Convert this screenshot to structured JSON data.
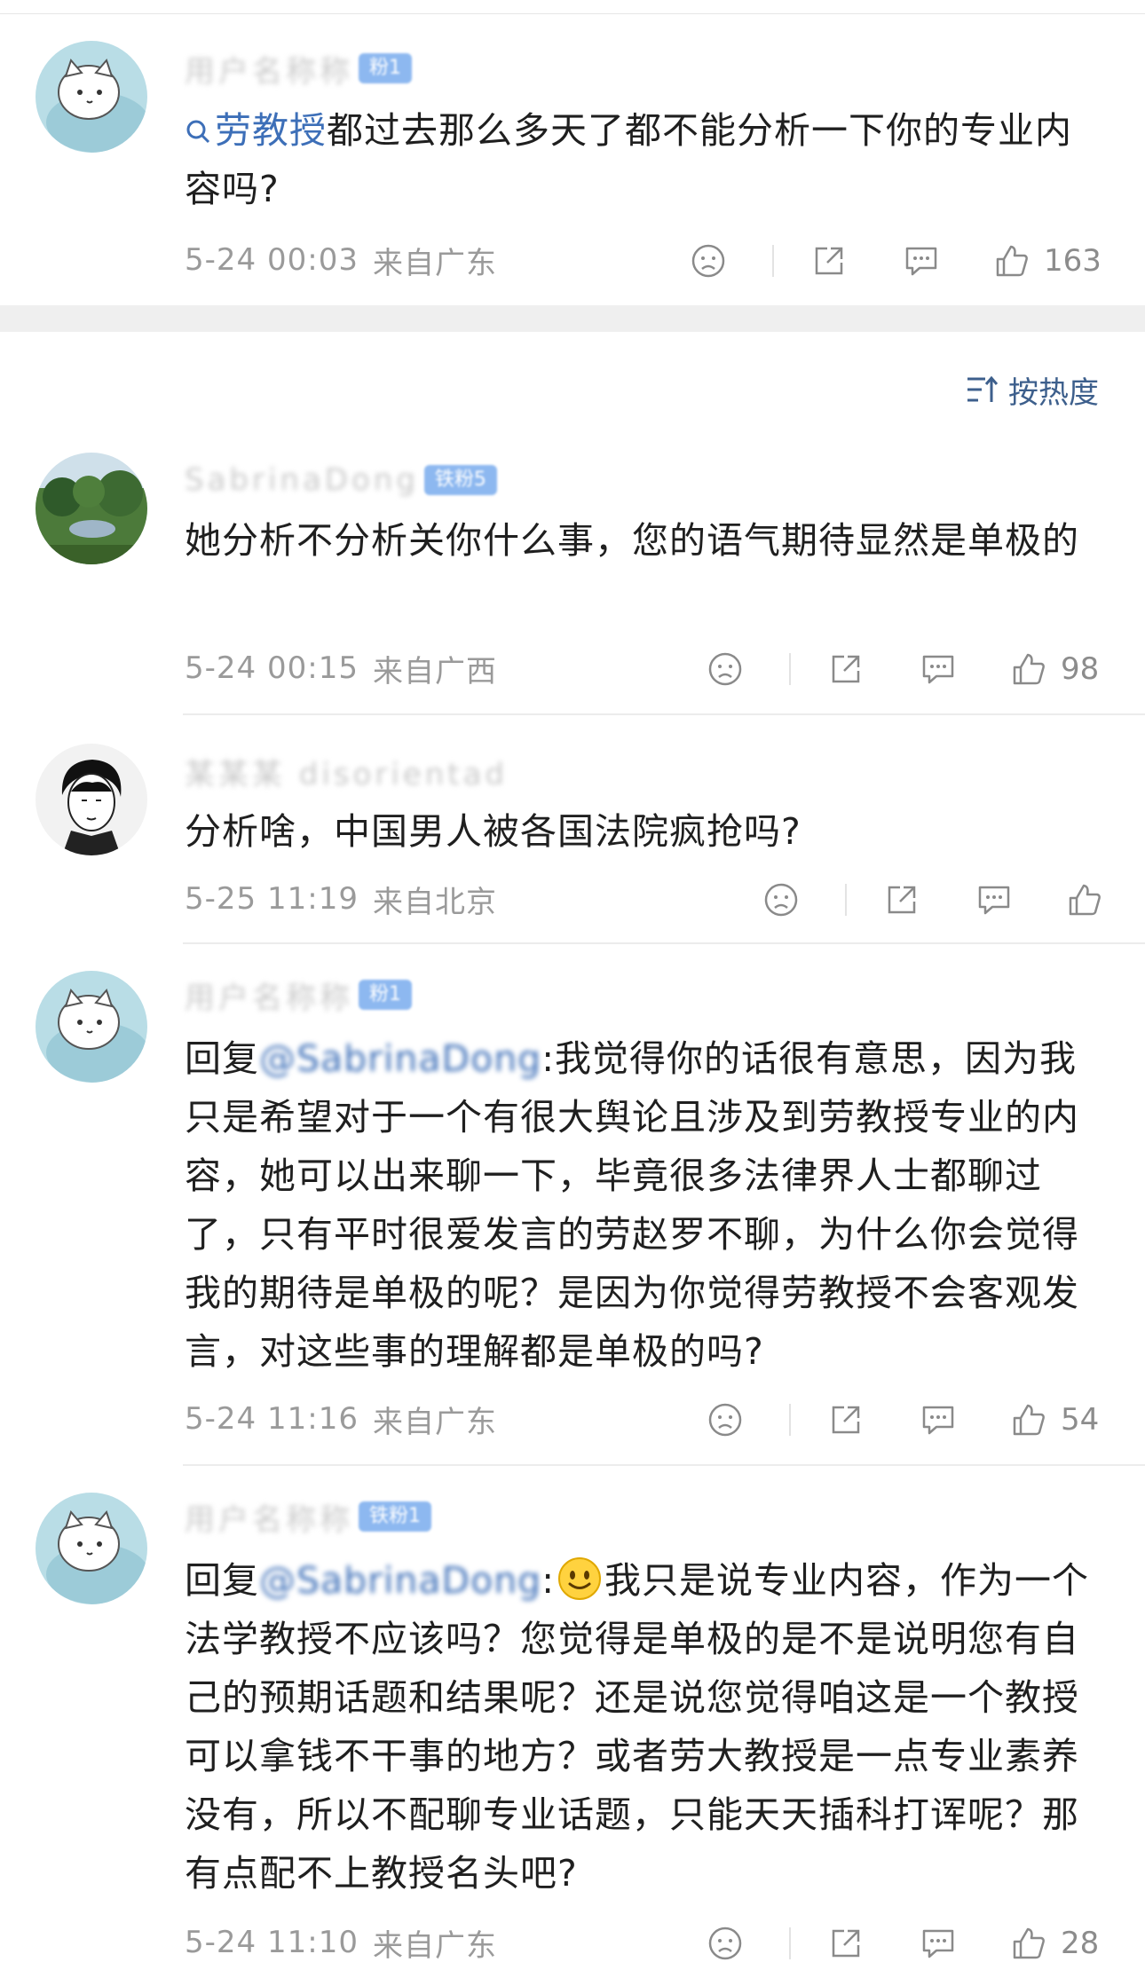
{
  "comments": [
    {
      "mention": "劳教授",
      "text": "都过去那么多天了都不能分析一下你的专业内容吗?",
      "badge": "粉1",
      "time": "5-24 00:03",
      "location": "来自广东",
      "likes": "163"
    },
    {
      "text": "她分析不分析关你什么事，您的语气期待显然是单极的",
      "badge": "铁粉5",
      "time": "5-24 00:15",
      "location": "来自广西",
      "likes": "98"
    },
    {
      "text": "分析啥，中国男人被各国法院疯抢吗?",
      "time": "5-25 11:19",
      "location": "来自北京",
      "likes": ""
    },
    {
      "reply_prefix": "回复",
      "reply_tail": ":我觉得你的话很有意思，因为我只是希望对于一个有很大舆论且涉及到劳教授专业的内容，她可以出来聊一下，毕竟很多法律界人士都聊过了，只有平时很爱发言的劳赵罗不聊，为什么你会觉得我的期待是单极的呢？是因为你觉得劳教授不会客观发言，对这些事的理解都是单极的吗?",
      "badge": "粉1",
      "time": "5-24 11:16",
      "location": "来自广东",
      "likes": "54"
    },
    {
      "reply_prefix": "回复",
      "reply_tail_a": ":",
      "reply_tail_b": "我只是说专业内容，作为一个法学教授不应该吗？您觉得是单极的是不是说明您有自己的预期话题和结果呢？还是说您觉得咱这是一个教授可以拿钱不干事的地方？或者劳大教授是一点专业素养没有，所以不配聊专业话题，只能天天插科打诨呢？那有点配不上教授名头吧?",
      "badge": "铁粉1",
      "time": "5-24 11:10",
      "location": "来自广东",
      "likes": "28"
    }
  ],
  "sort": {
    "label": "按热度"
  },
  "icons": {
    "dislike": "sad-face-icon",
    "share": "share-icon",
    "reply": "comment-bubble-icon",
    "like": "thumbs-up-icon",
    "sort": "sort-icon",
    "search": "search-icon"
  },
  "colors": {
    "link": "#3d6fb8",
    "meta": "#9a9a9a",
    "badge": "#8db8f0",
    "sort": "#3d5f8c"
  }
}
